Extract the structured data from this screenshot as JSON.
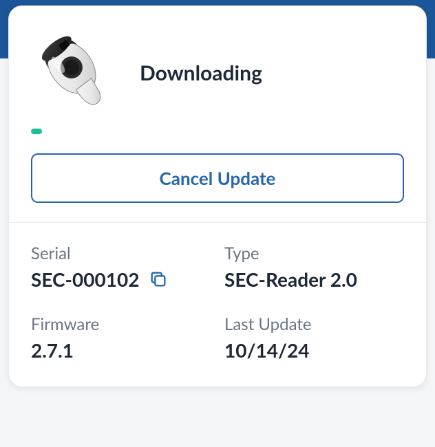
{
  "status": {
    "text": "Downloading",
    "progress_percent": 3
  },
  "actions": {
    "cancel_label": "Cancel Update"
  },
  "info": {
    "serial": {
      "label": "Serial",
      "value": "SEC-000102"
    },
    "type": {
      "label": "Type",
      "value": "SEC-Reader 2.0"
    },
    "firmware": {
      "label": "Firmware",
      "value": "2.7.1"
    },
    "last_update": {
      "label": "Last Update",
      "value": "10/14/24"
    }
  },
  "colors": {
    "primary": "#2566b0",
    "accent": "#1abc9c",
    "header": "#1a5699"
  }
}
